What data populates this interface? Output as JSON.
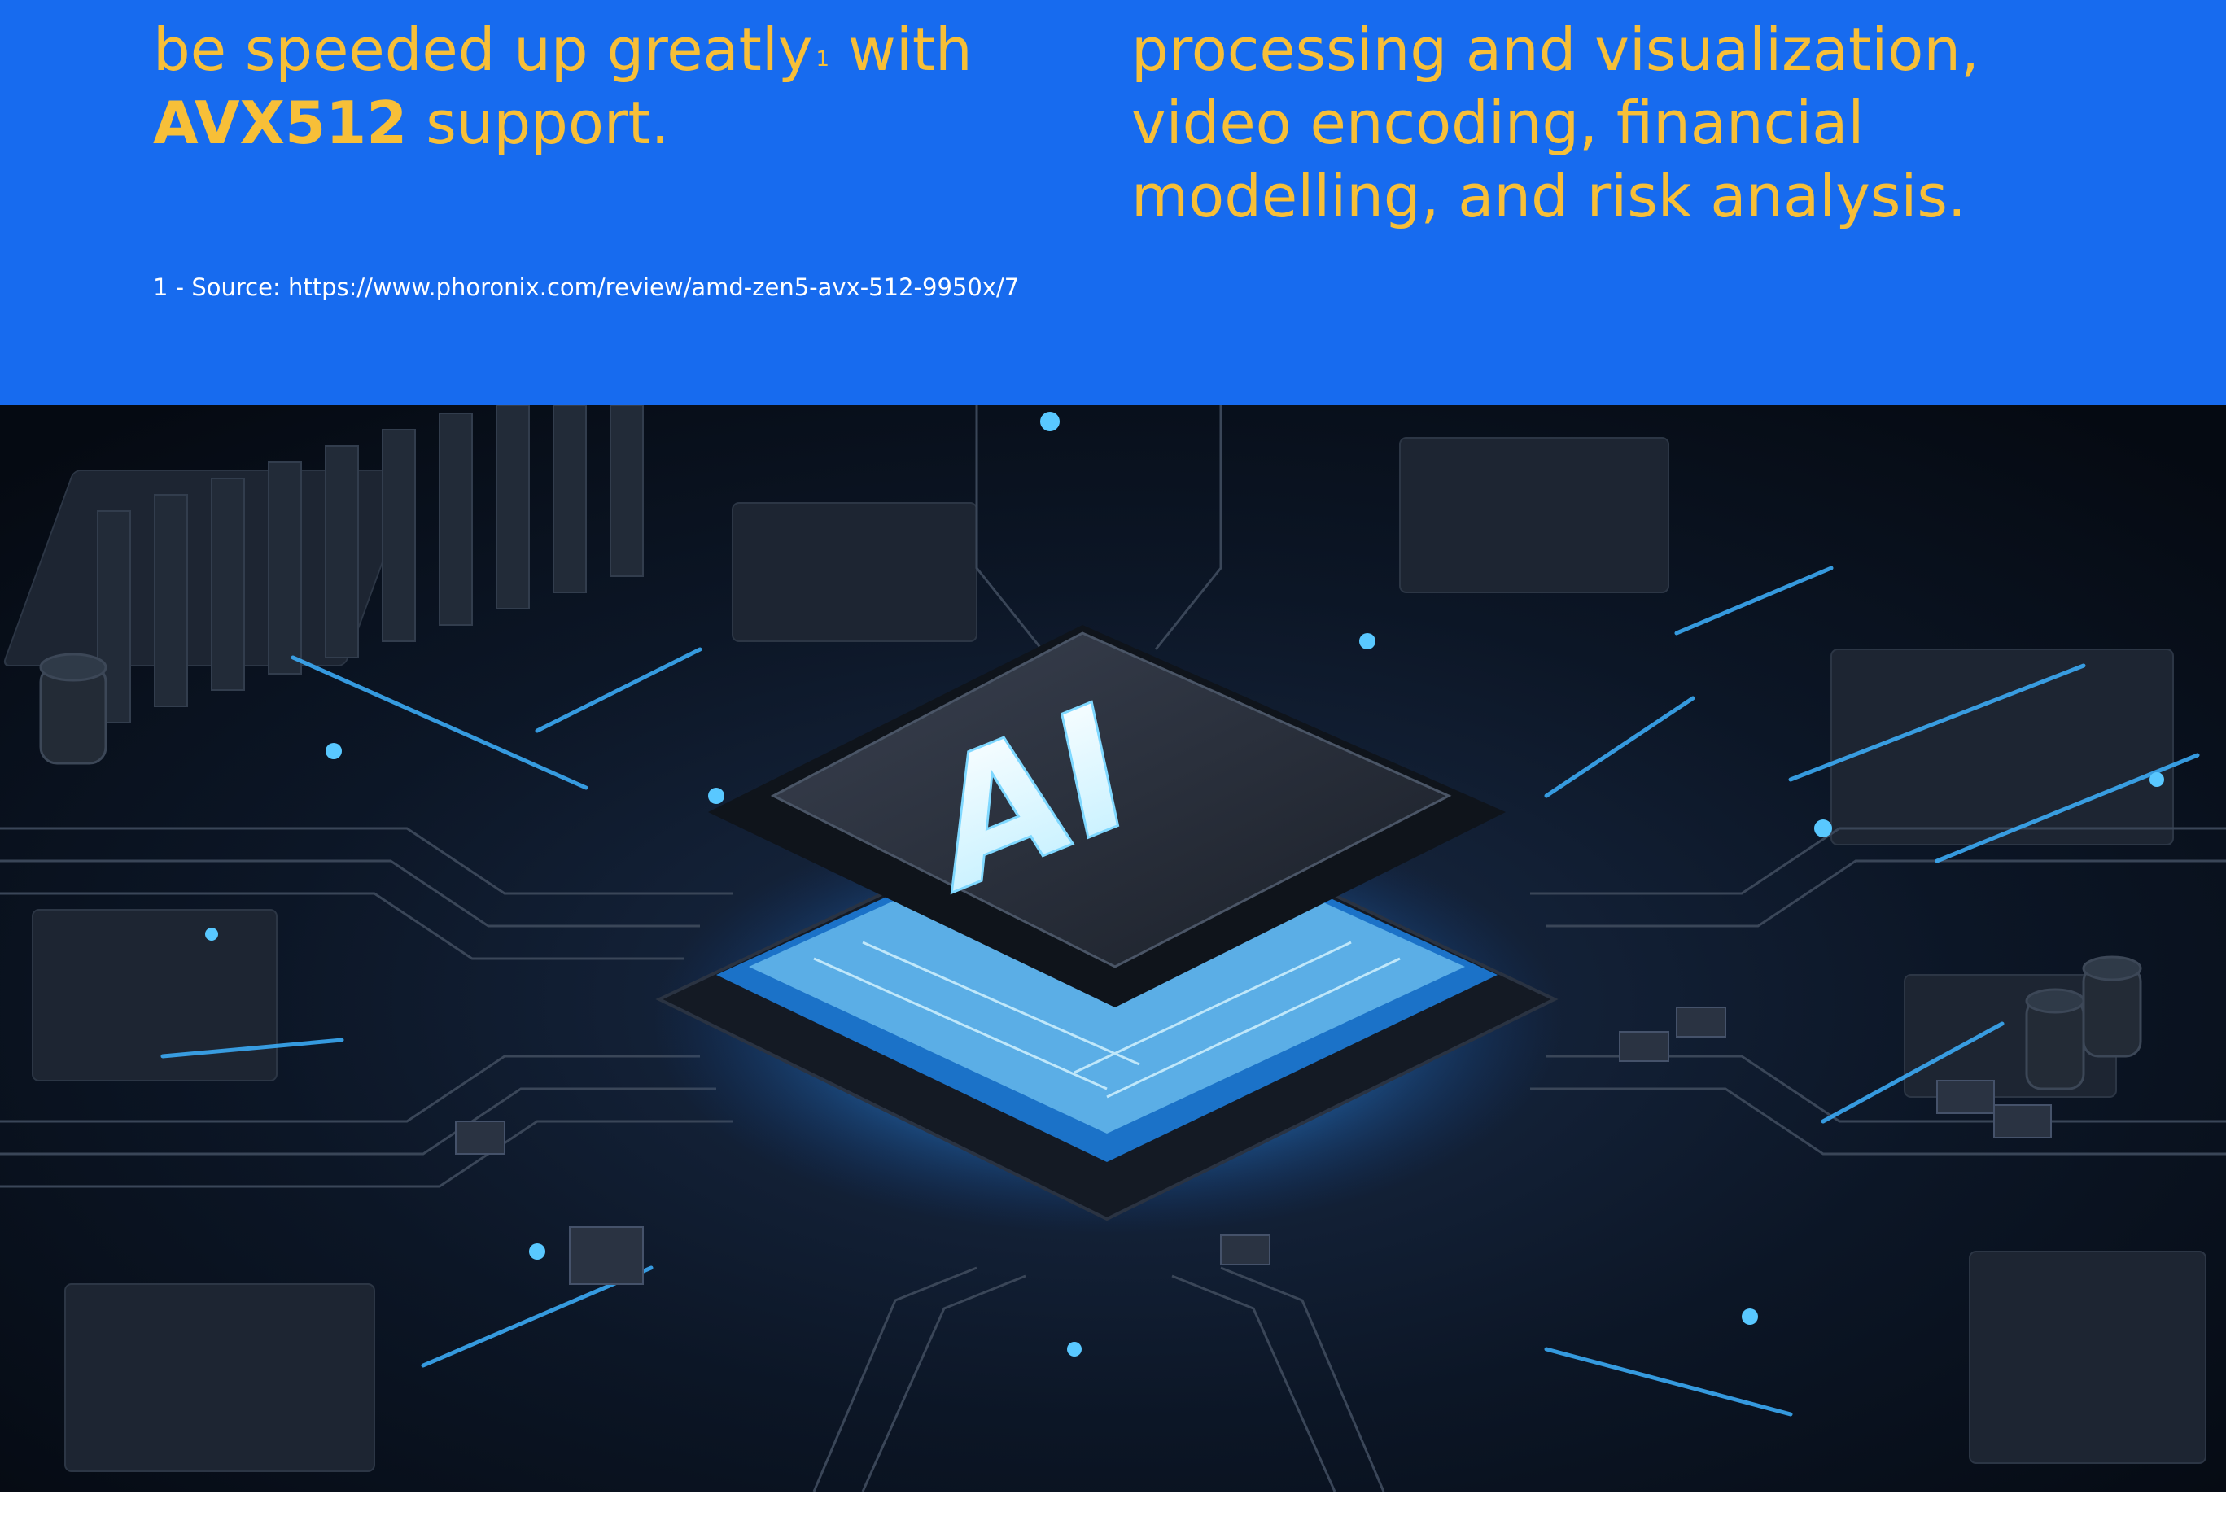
{
  "left_block": {
    "line1": "be speeded up greatly",
    "footnote_marker": "1",
    "line1_suffix": " with",
    "bold_term": "AVX512",
    "line2_suffix": " support."
  },
  "right_block": {
    "lines": [
      "processing and visualization,",
      "video encoding, financial",
      "modelling, and risk analysis."
    ]
  },
  "footnote": "1 - Source: https://www.phoronix.com/review/amd-zen5-avx-512-9950x/7",
  "hero_image": {
    "chip_label": "AI"
  },
  "colors": {
    "band": "#176bef",
    "headline": "#f7bf38",
    "footnote": "#ffffff",
    "glow": "#4fc3ff"
  }
}
